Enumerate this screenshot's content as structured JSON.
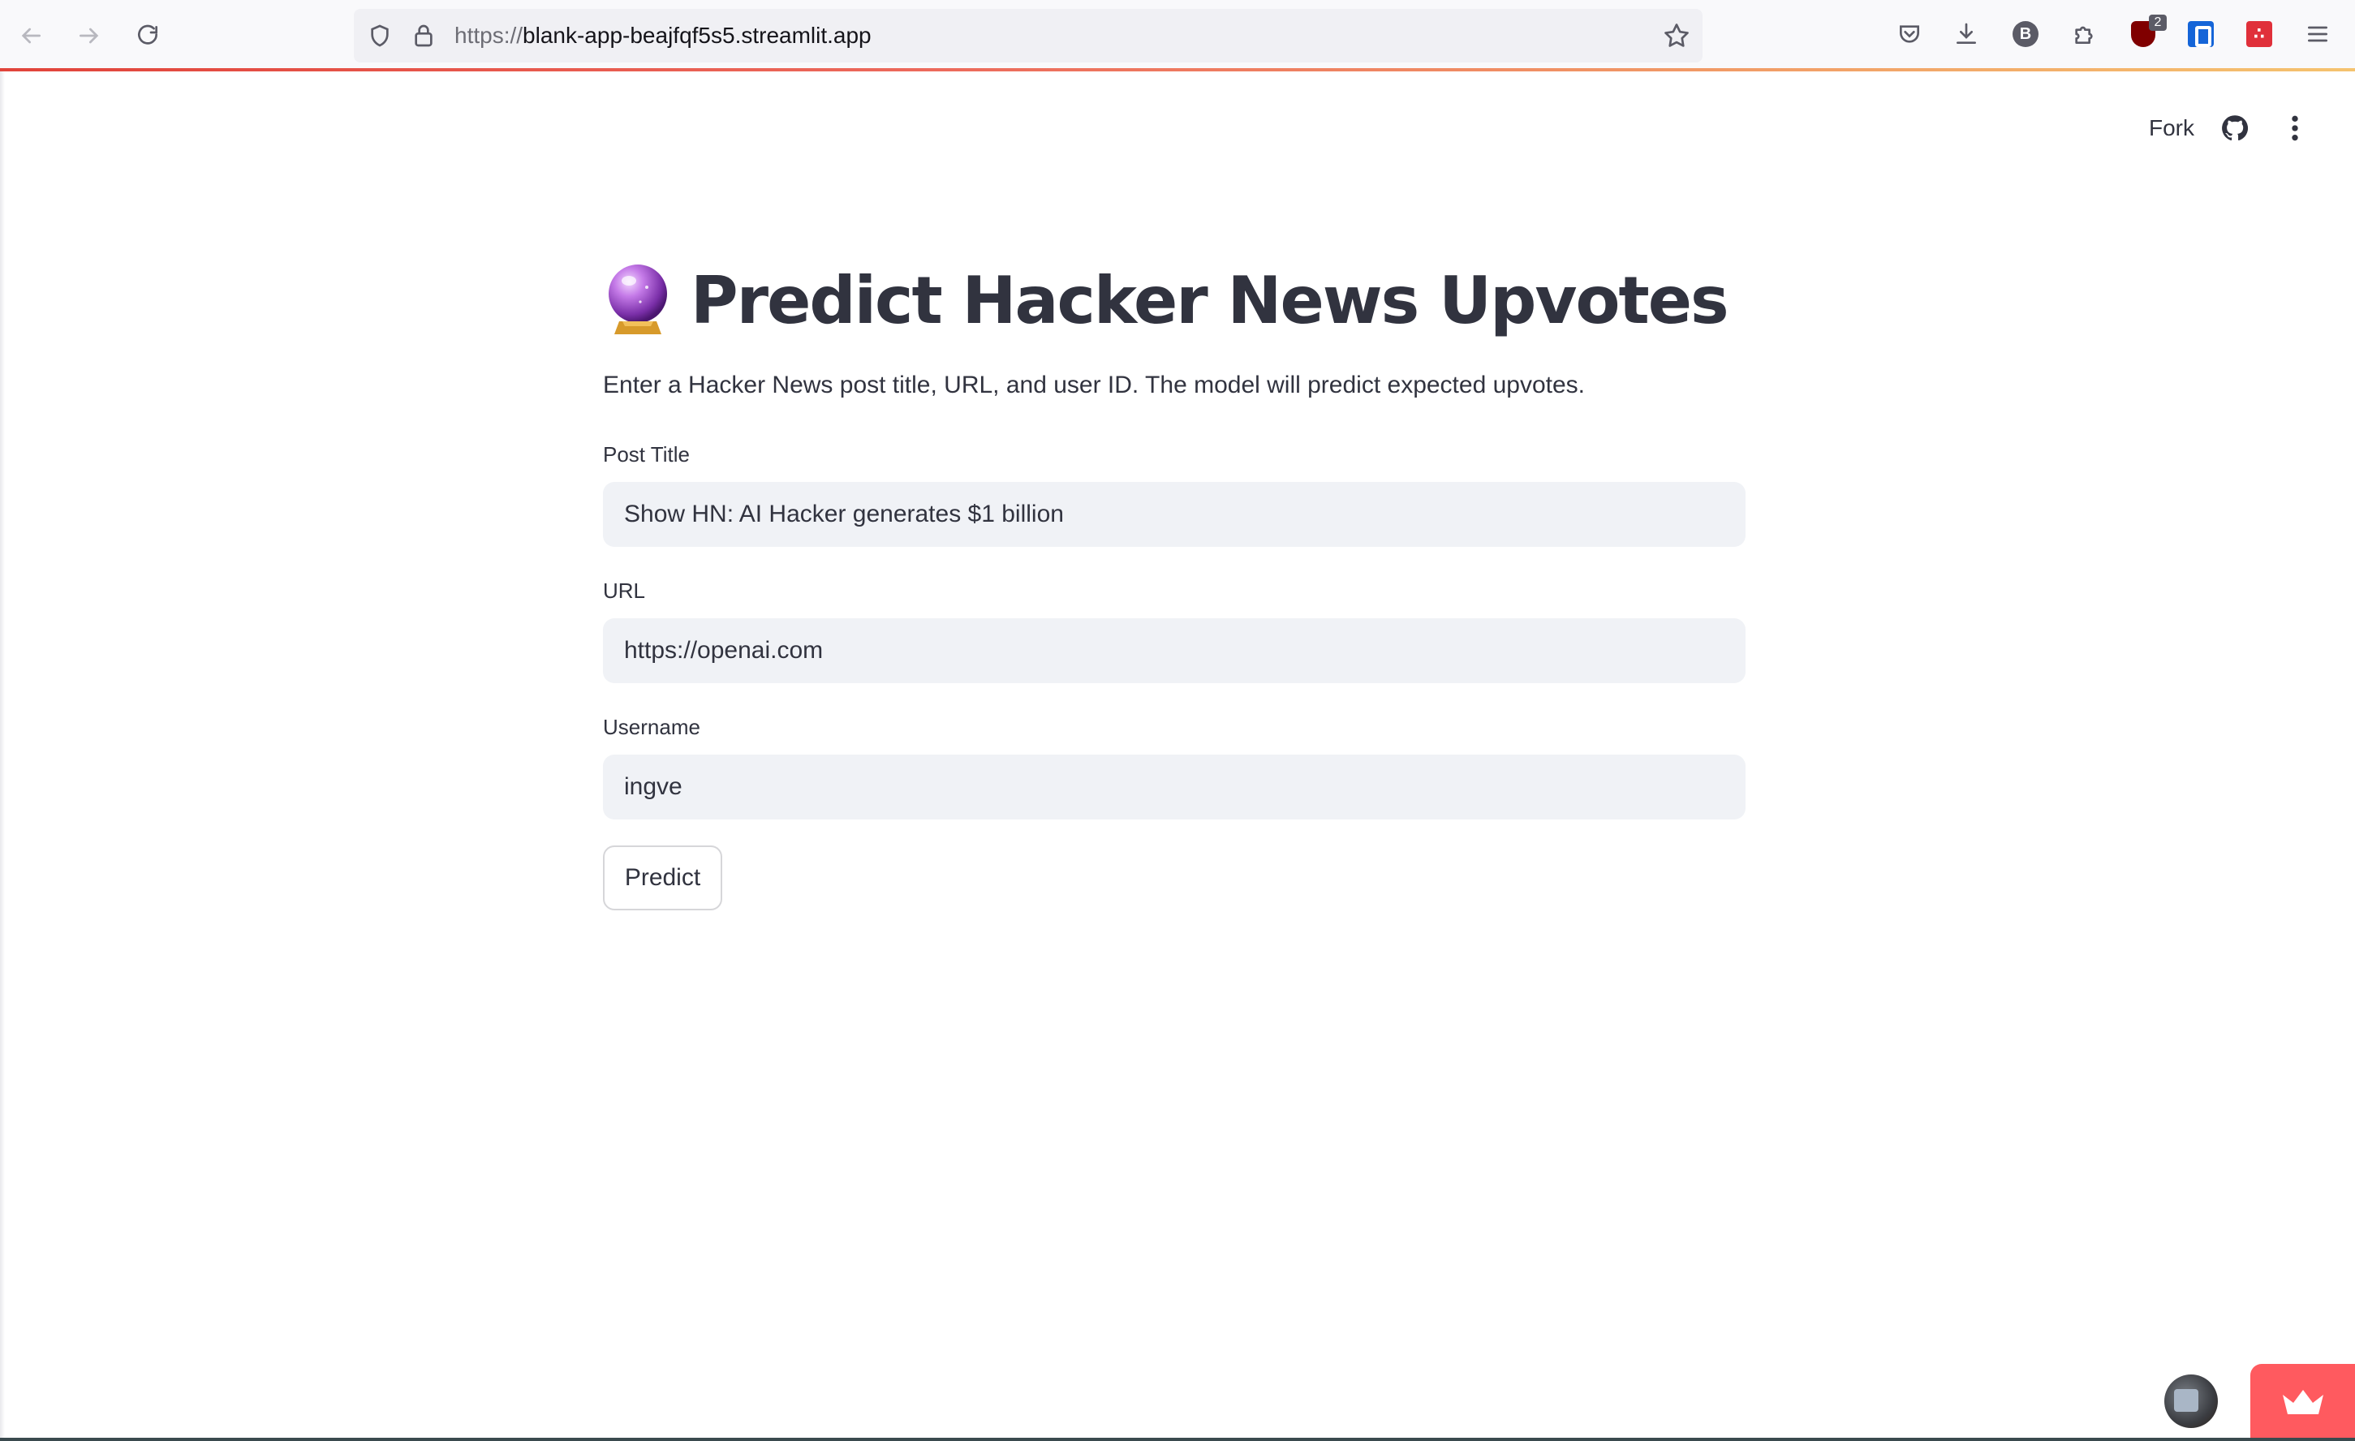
{
  "browser": {
    "url_scheme": "https://",
    "url_host": "blank-app-beajfqf5s5.streamlit.app",
    "ublock_count": "2",
    "profile_initial": "B"
  },
  "header": {
    "fork_label": "Fork"
  },
  "main": {
    "title": "Predict Hacker News Upvotes",
    "subtitle": "Enter a Hacker News post title, URL, and user ID. The model will predict expected upvotes.",
    "fields": [
      {
        "label": "Post Title",
        "value": "Show HN: AI Hacker generates $1 billion"
      },
      {
        "label": "URL",
        "value": "https://openai.com"
      },
      {
        "label": "Username",
        "value": "ingve"
      }
    ],
    "predict_label": "Predict"
  },
  "icons": {
    "title_icon": "crystal-ball-icon",
    "accent_color": "#ff5a5f"
  }
}
